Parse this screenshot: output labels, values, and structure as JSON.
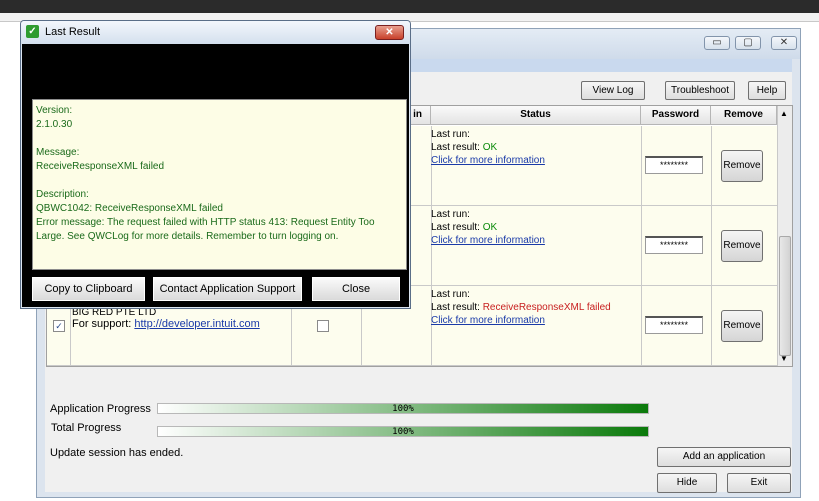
{
  "main_window": {
    "controls": {
      "minimize": "▭",
      "maximize": "▢",
      "close": "✕"
    },
    "toolbar": {
      "view_log": "View Log",
      "troubleshoot": "Troubleshoot",
      "help": "Help"
    },
    "table": {
      "headers": {
        "auto_run": "in",
        "status": "Status",
        "password": "Password",
        "remove": "Remove"
      },
      "rows": [
        {
          "last_run": "Last run:",
          "last_result_label": "Last result:",
          "last_result_value": "OK",
          "result_status": "ok",
          "info_link": "Click for more information",
          "password": "********",
          "remove": "Remove"
        },
        {
          "last_run": "Last run:",
          "last_result_label": "Last result:",
          "last_result_value": "OK",
          "result_status": "ok",
          "info_link": "Click for more information",
          "password": "********",
          "remove": "Remove"
        },
        {
          "app_name": "BIG RED PTE LTD",
          "support_label": "For support:",
          "support_link": "http://developer.intuit.com",
          "checked": "✓",
          "last_run": "Last run:",
          "last_result_label": "Last result:",
          "last_result_value": "ReceiveResponseXML failed",
          "result_status": "fail",
          "info_link": "Click for more information",
          "password": "********",
          "remove": "Remove"
        }
      ]
    },
    "progress": {
      "application_label": "Application Progress",
      "application_value": 100,
      "application_text": "100%",
      "total_label": "Total Progress",
      "total_value": 100,
      "total_text": "100%"
    },
    "status_message": "Update session has ended.",
    "buttons": {
      "add_application": "Add an application",
      "hide": "Hide",
      "exit": "Exit"
    }
  },
  "dialog": {
    "title": "Last Result",
    "close_glyph": "✕",
    "message": {
      "version_label": "Version:",
      "version_value": "2.1.0.30",
      "message_label": "Message:",
      "message_value": "ReceiveResponseXML failed",
      "description_label": "Description:",
      "description_code": "QBWC1042: ReceiveResponseXML failed",
      "description_text": "Error message: The request failed with HTTP status 413: Request Entity Too Large. See QWCLog for more details. Remember to turn logging on."
    },
    "buttons": {
      "copy": "Copy to Clipboard",
      "contact": "Contact Application Support",
      "close": "Close"
    }
  },
  "colors": {
    "ok": "#0a8a0a",
    "fail": "#c82020",
    "progress_fill": "#0b7a0b",
    "dialog_text": "#1a6a1a"
  }
}
